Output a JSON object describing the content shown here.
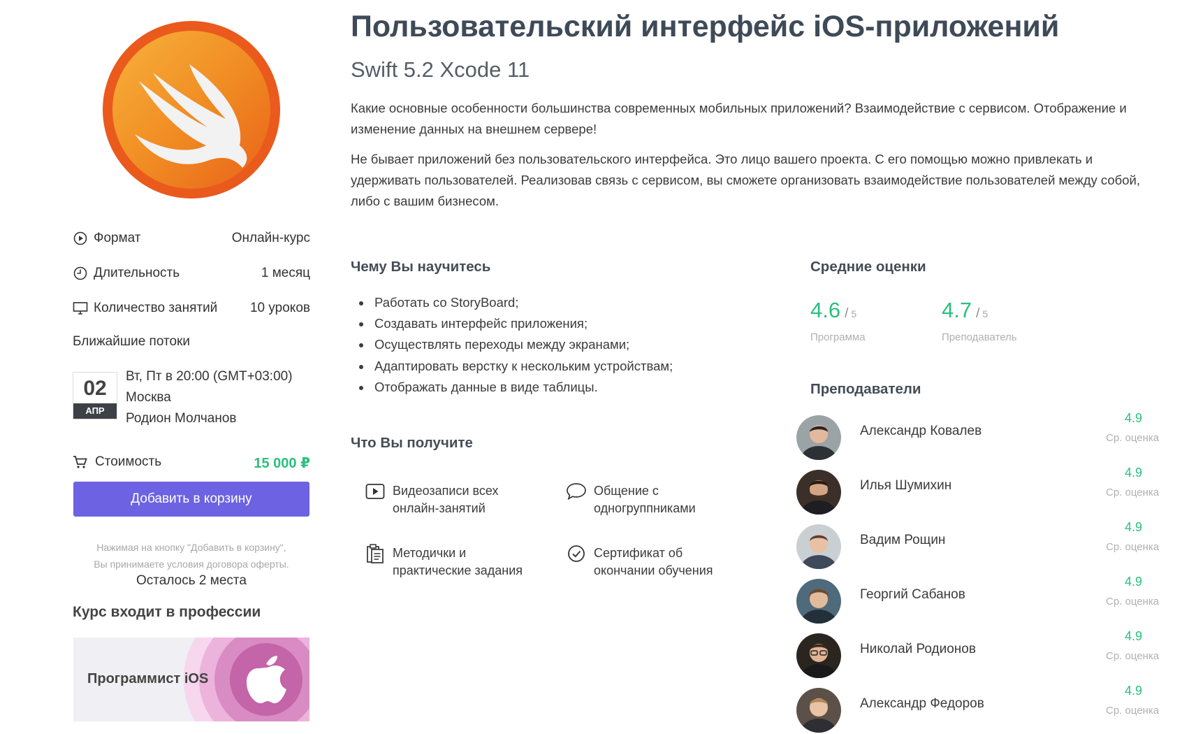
{
  "course": {
    "title": "Пользовательский интерфейс iOS-приложений",
    "subtitle": "Swift 5.2 Xcode 11",
    "description": [
      "Какие основные особенности большинства современных мобильных приложений? Взаимодействие с сервисом. Отображение и изменение данных на внешнем сервере!",
      "Не бывает приложений без пользовательского интерфейса. Это лицо вашего проекта. С его помощью можно привлекать и удерживать пользователей. Реализовав связь с сервисом, вы сможете организовать взаимодействие пользователей между собой, либо с вашим бизнесом."
    ]
  },
  "details": {
    "format_label": "Формат",
    "format_value": "Онлайн-курс",
    "duration_label": "Длительность",
    "duration_value": "1 месяц",
    "lessons_label": "Количество занятий",
    "lessons_value": "10 уроков"
  },
  "streams": {
    "title": "Ближайшие потоки",
    "day": "02",
    "month": "АПР",
    "schedule": "Вт, Пт в 20:00 (GMT+03:00)",
    "city": "Москва",
    "teacher": "Родион Молчанов"
  },
  "price": {
    "label": "Стоимость",
    "value": "15 000 ₽",
    "button": "Добавить в корзину",
    "note_line1": "Нажимая на кнопку \"Добавить в корзину\",",
    "note_line2": "Вы принимаете условия договора оферты.",
    "remaining": "Осталось 2 места"
  },
  "profession": {
    "title": "Курс входит в профессии",
    "name": "Программист iOS"
  },
  "learn": {
    "title": "Чему Вы научитесь",
    "items": [
      "Работать со StoryBoard;",
      "Создавать интерфейс приложения;",
      "Осуществлять переходы между экранами;",
      "Адаптировать верстку к нескольким устройствам;",
      "Отображать данные в виде таблицы."
    ]
  },
  "benefits": {
    "title": "Что Вы получите",
    "video_l1": "Видеозаписи всех",
    "video_l2": "онлайн-занятий",
    "chat_l1": "Общение с",
    "chat_l2": "одногруппниками",
    "docs_l1": "Методички и",
    "docs_l2": "практические задания",
    "cert_l1": "Сертификат об",
    "cert_l2": "окончании обучения"
  },
  "ratings": {
    "title": "Средние оценки",
    "program_score": "4.6",
    "program_label": "Программа",
    "teacher_score": "4.7",
    "teacher_label": "Преподаватель",
    "slash": "/",
    "max": "5"
  },
  "teachers": {
    "title": "Преподаватели",
    "score_label": "Ср. оценка",
    "items": [
      {
        "name": "Александр Ковалев",
        "score": "4.9"
      },
      {
        "name": "Илья Шумихин",
        "score": "4.9"
      },
      {
        "name": "Вадим Рощин",
        "score": "4.9"
      },
      {
        "name": "Георгий Сабанов",
        "score": "4.9"
      },
      {
        "name": "Николай Родионов",
        "score": "4.9"
      },
      {
        "name": "Александр Федоров",
        "score": "4.9"
      }
    ]
  },
  "colors": {
    "accent_green": "#2bbf7e",
    "button_purple": "#6c62e2",
    "swift_orange": "#ef6a1c"
  }
}
